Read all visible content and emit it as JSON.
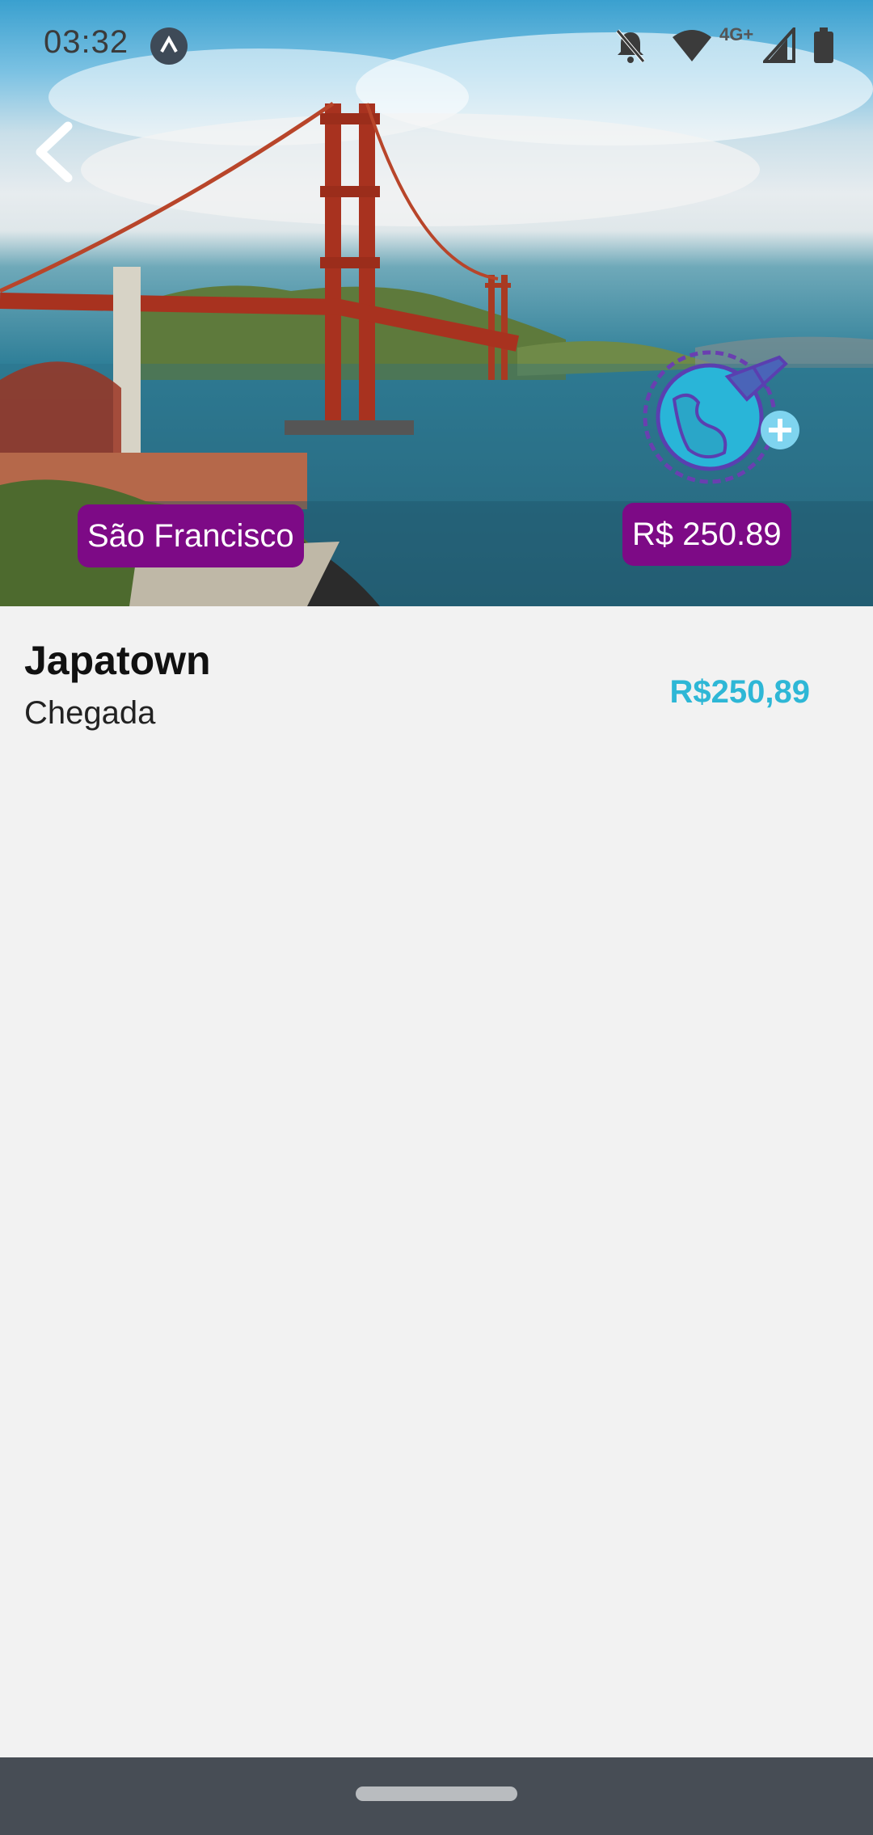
{
  "status_bar": {
    "time": "03:32",
    "network": "4G+",
    "icons": [
      "app-a-icon",
      "bell-off-icon",
      "wifi-icon",
      "signal-icon",
      "battery-icon"
    ]
  },
  "hero": {
    "image": "golden-gate-bridge-photo",
    "city_label": "São Francisco",
    "price_label": "R$ 250.89"
  },
  "details": {
    "title": "Japatown",
    "subtitle": "Chegada",
    "price": "R$250,89"
  },
  "colors": {
    "badge": "#7d0a86",
    "price_accent": "#2eb7d6",
    "background": "#f2f2f2",
    "nav_bar": "#474d55"
  }
}
